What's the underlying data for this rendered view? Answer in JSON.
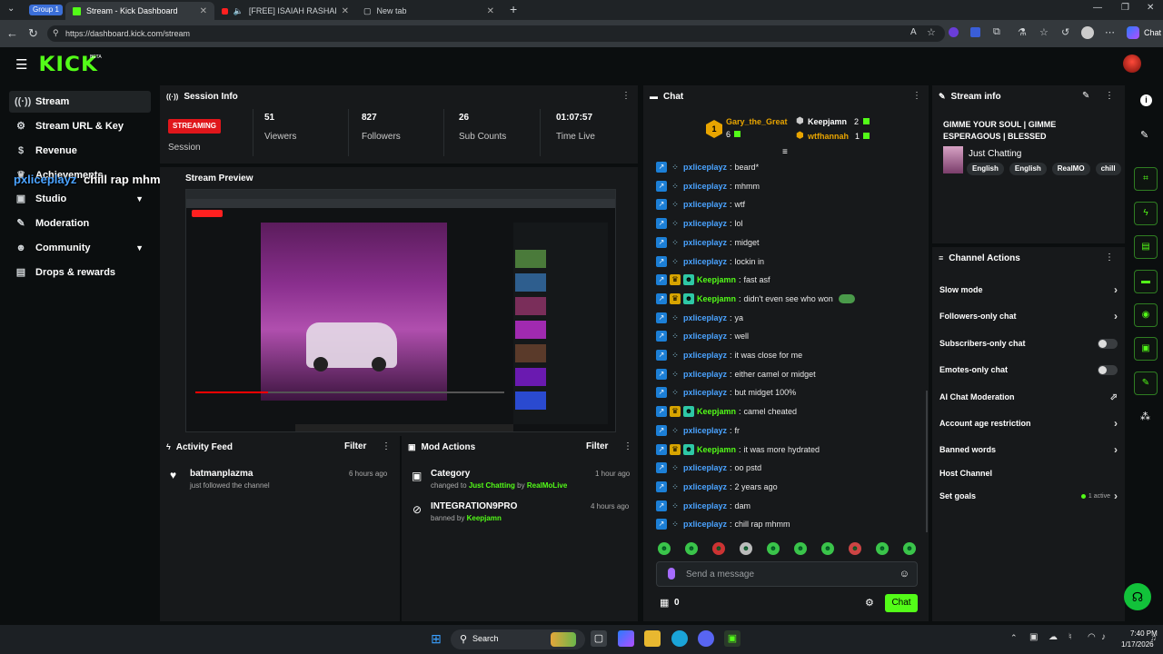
{
  "browser": {
    "group_label": "Group 1",
    "tabs": [
      {
        "title": "Stream - Kick Dashboard",
        "active": true
      },
      {
        "title": "[FREE] ISAIAH RASHAD X AAR",
        "active": false
      },
      {
        "title": "New tab",
        "active": false
      }
    ],
    "url": "https://dashboard.kick.com/stream",
    "copilot_label": "Chat"
  },
  "app": {
    "logo": "KICK",
    "logo_badge": "BETA"
  },
  "sidebar": {
    "items": [
      {
        "label": "Stream",
        "icon": "broadcast-icon"
      },
      {
        "label": "Stream URL & Key",
        "icon": "gear-icon"
      },
      {
        "label": "Revenue",
        "icon": "dollar-icon"
      },
      {
        "label": "Achievements",
        "icon": "trophy-icon"
      },
      {
        "label": "Studio",
        "icon": "studio-icon"
      },
      {
        "label": "Moderation",
        "icon": "wrench-icon"
      },
      {
        "label": "Community",
        "icon": "people-icon"
      },
      {
        "label": "Drops & rewards",
        "icon": "gift-icon"
      }
    ]
  },
  "overlay_text": {
    "user": "pxliceplayz",
    "message": "chill rap mhmm"
  },
  "session": {
    "title": "Session Info",
    "status_badge": "STREAMING",
    "status_label": "Session",
    "stats": [
      {
        "value": "51",
        "label": "Viewers"
      },
      {
        "value": "827",
        "label": "Followers"
      },
      {
        "value": "26",
        "label": "Sub Counts"
      },
      {
        "value": "01:07:57",
        "label": "Time Live"
      }
    ]
  },
  "preview": {
    "title": "Stream Preview"
  },
  "activity": {
    "title": "Activity Feed",
    "filter": "Filter",
    "items": [
      {
        "user": "batmanplazma",
        "text": "just followed the channel",
        "time": "6 hours ago"
      }
    ]
  },
  "mod_actions": {
    "title": "Mod Actions",
    "filter": "Filter",
    "items": [
      {
        "title": "Category",
        "prefix": "changed to",
        "target": "Just Chatting",
        "by_word": "by",
        "actor": "RealMoLive",
        "time": "1 hour ago"
      },
      {
        "title": "INTEGRATION9PRO",
        "prefix": "banned by",
        "actor": "Keepjamn",
        "time": "4 hours ago"
      }
    ]
  },
  "chat": {
    "title": "Chat",
    "top_gifters": [
      {
        "name": "Gary_the_Great",
        "count": "6",
        "rank": "1"
      },
      {
        "name": "Keepjamn",
        "count": "2"
      },
      {
        "name": "wtfhannah",
        "count": "1"
      }
    ],
    "messages": [
      {
        "user": "pxliceplayz",
        "text": "beard*",
        "mod": false
      },
      {
        "user": "pxliceplayz",
        "text": "mhmm",
        "mod": false
      },
      {
        "user": "pxliceplayz",
        "text": "wtf",
        "mod": false
      },
      {
        "user": "pxliceplayz",
        "text": "lol",
        "mod": false
      },
      {
        "user": "pxliceplayz",
        "text": "midget",
        "mod": false
      },
      {
        "user": "pxliceplayz",
        "text": "lockin in",
        "mod": false
      },
      {
        "user": "Keepjamn",
        "text": "fast asf",
        "mod": true
      },
      {
        "user": "Keepjamn",
        "text": "didn't even see who won",
        "mod": true
      },
      {
        "user": "pxliceplayz",
        "text": "ya",
        "mod": false
      },
      {
        "user": "pxliceplayz",
        "text": "well",
        "mod": false
      },
      {
        "user": "pxliceplayz",
        "text": "it was close for me",
        "mod": false
      },
      {
        "user": "pxliceplayz",
        "text": "either camel or midget",
        "mod": false
      },
      {
        "user": "pxliceplayz",
        "text": "but midget 100%",
        "mod": false
      },
      {
        "user": "Keepjamn",
        "text": "camel cheated",
        "mod": true
      },
      {
        "user": "pxliceplayz",
        "text": "fr",
        "mod": false
      },
      {
        "user": "Keepjamn",
        "text": "it was more hydrated",
        "mod": true
      },
      {
        "user": "pxliceplayz",
        "text": "oo pstd",
        "mod": false
      },
      {
        "user": "pxliceplayz",
        "text": "2 years ago",
        "mod": false
      },
      {
        "user": "pxliceplayz",
        "text": "dam",
        "mod": false
      },
      {
        "user": "pxliceplayz",
        "text": "chill rap mhmm",
        "mod": false
      }
    ],
    "input_placeholder": "Send a message",
    "points": "0",
    "send_label": "Chat",
    "colors": {
      "viewer": "#4aa3ff",
      "mod": "#53fc18"
    }
  },
  "stream_info": {
    "title": "Stream info",
    "stream_title": "GIMME YOUR SOUL | GIMME ESPERAGOUS | BLESSED",
    "category": "Just Chatting",
    "tags": [
      "English",
      "English",
      "RealMO",
      "chill"
    ]
  },
  "channel_actions": {
    "title": "Channel Actions",
    "rows": [
      {
        "label": "Slow mode",
        "control": "arrow"
      },
      {
        "label": "Followers-only chat",
        "control": "arrow"
      },
      {
        "label": "Subscribers-only chat",
        "control": "toggle"
      },
      {
        "label": "Emotes-only chat",
        "control": "toggle"
      },
      {
        "label": "AI Chat Moderation",
        "control": "chart"
      },
      {
        "label": "Account age restriction",
        "control": "arrow"
      },
      {
        "label": "Banned words",
        "control": "arrow"
      },
      {
        "label": "Host Channel",
        "control": "none"
      },
      {
        "label": "Set goals",
        "control": "arrow",
        "status": "1 active"
      }
    ]
  },
  "taskbar": {
    "search_label": "Search",
    "time": "7:40 PM",
    "date": "1/17/2026"
  }
}
